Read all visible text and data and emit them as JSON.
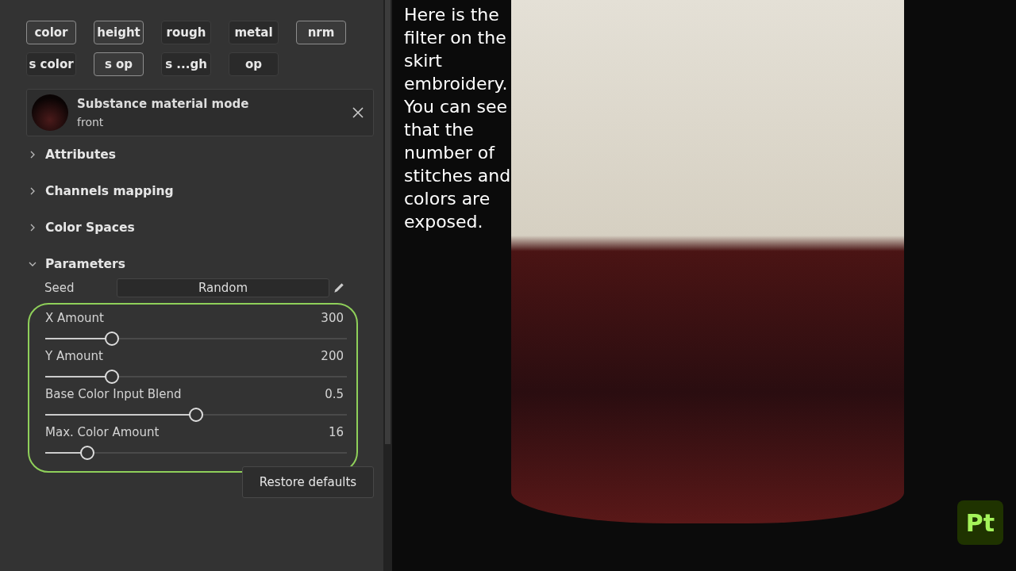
{
  "channels": [
    {
      "label": "color",
      "selected": true
    },
    {
      "label": "height",
      "selected": true
    },
    {
      "label": "rough",
      "selected": false
    },
    {
      "label": "metal",
      "selected": false
    },
    {
      "label": "nrm",
      "selected": true
    },
    {
      "label": "s color",
      "selected": false
    },
    {
      "label": "s op",
      "selected": true
    },
    {
      "label": "s ...gh",
      "selected": false
    },
    {
      "label": "op",
      "selected": false
    }
  ],
  "material": {
    "title": "Substance material mode",
    "subtitle": "front"
  },
  "sections": [
    {
      "label": "Attributes",
      "expanded": false
    },
    {
      "label": "Channels mapping",
      "expanded": false
    },
    {
      "label": "Color Spaces",
      "expanded": false
    },
    {
      "label": "Parameters",
      "expanded": true
    }
  ],
  "seed": {
    "label": "Seed",
    "value": "Random"
  },
  "sliders": [
    {
      "label": "X Amount",
      "reading": "300",
      "level": 0.22
    },
    {
      "label": "Y Amount",
      "reading": "200",
      "level": 0.22
    },
    {
      "label": "Base Color Input Blend",
      "reading": "0.5",
      "level": 0.5
    },
    {
      "label": "Max. Color Amount",
      "reading": "16",
      "level": 0.14
    }
  ],
  "restore_button": "Restore defaults",
  "caption": "Here is the filter on the skirt embroidery. You can see that the number of stitches and colors are exposed.",
  "logo": "Pt"
}
